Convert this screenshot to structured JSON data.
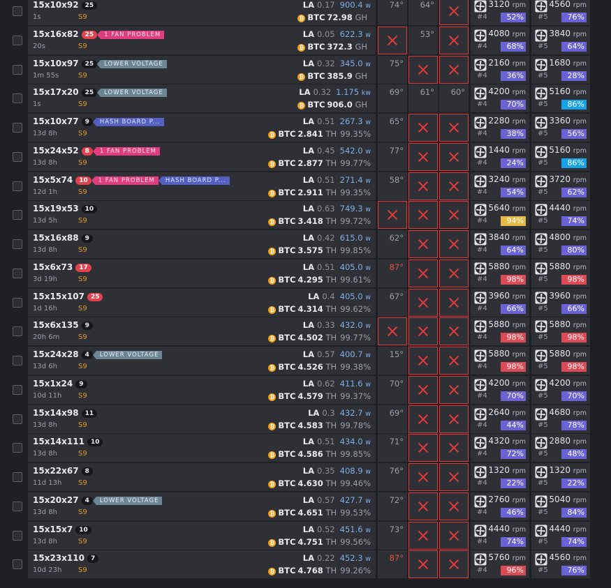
{
  "colors": {
    "pct_normal": "#6a63d6",
    "pct_warn": "#e5b946",
    "pct_danger": "#dc4a55",
    "pct_cyan": "#17a1e6"
  },
  "icons": {
    "fan": "fan-icon",
    "coin": "bitcoin-icon"
  },
  "la_label": "LA",
  "coin_label": "BTC",
  "coin_glyph": "₿",
  "fan_ids": [
    "#4",
    "#5"
  ],
  "rpm_unit": "rpm",
  "rows": [
    {
      "name": "15x10x92",
      "count": "25",
      "count_red": false,
      "tags": [],
      "age": "1s",
      "model": "S9",
      "la": "0.17",
      "power": "900.4",
      "power_unit": "w",
      "hashrate": "72.98",
      "hash_unit": "GH",
      "eff": "",
      "temps": [
        {
          "v": "74°",
          "err": false,
          "hot": false
        },
        {
          "v": "64°",
          "err": false,
          "hot": false
        },
        {
          "v": "",
          "err": true,
          "hot": false
        }
      ],
      "fans": [
        {
          "rpm": "3120",
          "pct": "52%",
          "color": "normal"
        },
        {
          "rpm": "4560",
          "pct": "76%",
          "color": "normal"
        }
      ]
    },
    {
      "name": "15x16x82",
      "count": "25",
      "count_red": true,
      "tags": [
        {
          "t": "1 FAN PROBLEM",
          "k": "fan"
        }
      ],
      "age": "20s",
      "model": "S9",
      "la": "0.05",
      "power": "622.3",
      "power_unit": "w",
      "hashrate": "372.3",
      "hash_unit": "GH",
      "eff": "",
      "temps": [
        {
          "v": "",
          "err": true,
          "hot": false
        },
        {
          "v": "53°",
          "err": false,
          "hot": false
        },
        {
          "v": "",
          "err": true,
          "hot": false
        }
      ],
      "fans": [
        {
          "rpm": "4080",
          "pct": "68%",
          "color": "normal"
        },
        {
          "rpm": "3840",
          "pct": "64%",
          "color": "normal"
        }
      ]
    },
    {
      "name": "15x10x97",
      "count": "25",
      "count_red": false,
      "tags": [
        {
          "t": "LOWER VOLTAGE",
          "k": "volt"
        }
      ],
      "age": "1m 55s",
      "model": "S9",
      "la": "0.32",
      "power": "345.0",
      "power_unit": "w",
      "hashrate": "385.9",
      "hash_unit": "GH",
      "eff": "",
      "temps": [
        {
          "v": "75°",
          "err": false,
          "hot": false
        },
        {
          "v": "",
          "err": true,
          "hot": false
        },
        {
          "v": "",
          "err": true,
          "hot": false
        }
      ],
      "fans": [
        {
          "rpm": "2160",
          "pct": "36%",
          "color": "normal"
        },
        {
          "rpm": "1680",
          "pct": "28%",
          "color": "normal"
        }
      ]
    },
    {
      "name": "15x17x20",
      "count": "25",
      "count_red": false,
      "tags": [
        {
          "t": "LOWER VOLTAGE",
          "k": "volt"
        }
      ],
      "age": "1s",
      "model": "S9",
      "la": "0.32",
      "power": "1.175",
      "power_unit": "kw",
      "hashrate": "906.0",
      "hash_unit": "GH",
      "eff": "",
      "temps": [
        {
          "v": "69°",
          "err": false,
          "hot": false
        },
        {
          "v": "61°",
          "err": false,
          "hot": false
        },
        {
          "v": "60°",
          "err": false,
          "hot": false
        }
      ],
      "fans": [
        {
          "rpm": "4200",
          "pct": "70%",
          "color": "normal"
        },
        {
          "rpm": "5160",
          "pct": "86%",
          "color": "cyan"
        }
      ]
    },
    {
      "name": "15x10x77",
      "count": "9",
      "count_red": false,
      "tags": [
        {
          "t": "HASH BOARD P...",
          "k": "hb"
        }
      ],
      "age": "13d 8h",
      "model": "S9",
      "la": "0.51",
      "power": "267.3",
      "power_unit": "w",
      "hashrate": "2.841",
      "hash_unit": "TH",
      "eff": "99.35%",
      "temps": [
        {
          "v": "65°",
          "err": false,
          "hot": false
        },
        {
          "v": "",
          "err": true,
          "hot": false
        },
        {
          "v": "",
          "err": true,
          "hot": false
        }
      ],
      "fans": [
        {
          "rpm": "2280",
          "pct": "38%",
          "color": "normal"
        },
        {
          "rpm": "3360",
          "pct": "56%",
          "color": "normal"
        }
      ]
    },
    {
      "name": "15x24x52",
      "count": "8",
      "count_red": true,
      "tags": [
        {
          "t": "1 FAN PROBLEM",
          "k": "fan"
        }
      ],
      "age": "13d 8h",
      "model": "S9",
      "la": "0.45",
      "power": "542.0",
      "power_unit": "w",
      "hashrate": "2.877",
      "hash_unit": "TH",
      "eff": "99.77%",
      "temps": [
        {
          "v": "77°",
          "err": false,
          "hot": false
        },
        {
          "v": "",
          "err": true,
          "hot": false
        },
        {
          "v": "",
          "err": true,
          "hot": false
        }
      ],
      "fans": [
        {
          "rpm": "1440",
          "pct": "24%",
          "color": "normal"
        },
        {
          "rpm": "5160",
          "pct": "86%",
          "color": "cyan"
        }
      ]
    },
    {
      "name": "15x5x74",
      "count": "10",
      "count_red": true,
      "tags": [
        {
          "t": "1 FAN PROBLEM",
          "k": "fan"
        },
        {
          "t": "HASH BOARD P...",
          "k": "hb"
        }
      ],
      "age": "12d 1h",
      "model": "S9",
      "la": "0.51",
      "power": "271.4",
      "power_unit": "w",
      "hashrate": "2.911",
      "hash_unit": "TH",
      "eff": "99.35%",
      "temps": [
        {
          "v": "58°",
          "err": false,
          "hot": false
        },
        {
          "v": "",
          "err": true,
          "hot": false
        },
        {
          "v": "",
          "err": true,
          "hot": false
        }
      ],
      "fans": [
        {
          "rpm": "3240",
          "pct": "54%",
          "color": "normal"
        },
        {
          "rpm": "3720",
          "pct": "62%",
          "color": "normal"
        }
      ]
    },
    {
      "name": "15x19x53",
      "count": "10",
      "count_red": false,
      "tags": [],
      "age": "13d 5h",
      "model": "S9",
      "la": "0.63",
      "power": "749.3",
      "power_unit": "w",
      "hashrate": "3.418",
      "hash_unit": "TH",
      "eff": "99.72%",
      "temps": [
        {
          "v": "",
          "err": true,
          "hot": false
        },
        {
          "v": "",
          "err": true,
          "hot": false
        },
        {
          "v": "",
          "err": true,
          "hot": false
        }
      ],
      "fans": [
        {
          "rpm": "5640",
          "pct": "94%",
          "color": "warn"
        },
        {
          "rpm": "4440",
          "pct": "74%",
          "color": "normal"
        }
      ]
    },
    {
      "name": "15x16x88",
      "count": "9",
      "count_red": false,
      "tags": [],
      "age": "13d 8h",
      "model": "S9",
      "la": "0.42",
      "power": "615.0",
      "power_unit": "w",
      "hashrate": "3.575",
      "hash_unit": "TH",
      "eff": "99.85%",
      "temps": [
        {
          "v": "62°",
          "err": false,
          "hot": false
        },
        {
          "v": "",
          "err": true,
          "hot": false
        },
        {
          "v": "",
          "err": true,
          "hot": false
        }
      ],
      "fans": [
        {
          "rpm": "3840",
          "pct": "64%",
          "color": "normal"
        },
        {
          "rpm": "4800",
          "pct": "80%",
          "color": "normal"
        }
      ]
    },
    {
      "name": "15x6x73",
      "count": "17",
      "count_red": true,
      "tags": [],
      "age": "3d 19h",
      "model": "S9",
      "la": "0.51",
      "power": "405.0",
      "power_unit": "w",
      "hashrate": "4.295",
      "hash_unit": "TH",
      "eff": "99.61%",
      "temps": [
        {
          "v": "87°",
          "err": false,
          "hot": true
        },
        {
          "v": "",
          "err": true,
          "hot": false
        },
        {
          "v": "",
          "err": true,
          "hot": false
        }
      ],
      "fans": [
        {
          "rpm": "5880",
          "pct": "98%",
          "color": "danger"
        },
        {
          "rpm": "5880",
          "pct": "98%",
          "color": "danger"
        }
      ]
    },
    {
      "name": "15x15x107",
      "count": "25",
      "count_red": true,
      "tags": [],
      "age": "1d 16h",
      "model": "S9",
      "la": "0.4",
      "power": "405.0",
      "power_unit": "w",
      "hashrate": "4.314",
      "hash_unit": "TH",
      "eff": "99.62%",
      "temps": [
        {
          "v": "67°",
          "err": false,
          "hot": false
        },
        {
          "v": "",
          "err": true,
          "hot": false
        },
        {
          "v": "",
          "err": true,
          "hot": false
        }
      ],
      "fans": [
        {
          "rpm": "3960",
          "pct": "66%",
          "color": "normal"
        },
        {
          "rpm": "3960",
          "pct": "66%",
          "color": "normal"
        }
      ]
    },
    {
      "name": "15x6x135",
      "count": "9",
      "count_red": false,
      "tags": [],
      "age": "20h 6m",
      "model": "S9",
      "la": "0.33",
      "power": "432.0",
      "power_unit": "w",
      "hashrate": "4.502",
      "hash_unit": "TH",
      "eff": "99.77%",
      "temps": [
        {
          "v": "",
          "err": true,
          "hot": false
        },
        {
          "v": "",
          "err": true,
          "hot": false
        },
        {
          "v": "",
          "err": true,
          "hot": false
        }
      ],
      "fans": [
        {
          "rpm": "5880",
          "pct": "98%",
          "color": "danger"
        },
        {
          "rpm": "5880",
          "pct": "98%",
          "color": "danger"
        }
      ]
    },
    {
      "name": "15x24x28",
      "count": "4",
      "count_red": false,
      "tags": [
        {
          "t": "LOWER VOLTAGE",
          "k": "volt"
        }
      ],
      "age": "13d 6h",
      "model": "S9",
      "la": "0.57",
      "power": "400.7",
      "power_unit": "w",
      "hashrate": "4.526",
      "hash_unit": "TH",
      "eff": "99.38%",
      "temps": [
        {
          "v": "15°",
          "err": false,
          "hot": false
        },
        {
          "v": "",
          "err": true,
          "hot": false
        },
        {
          "v": "",
          "err": true,
          "hot": false
        }
      ],
      "fans": [
        {
          "rpm": "5880",
          "pct": "98%",
          "color": "danger"
        },
        {
          "rpm": "5880",
          "pct": "98%",
          "color": "danger"
        }
      ]
    },
    {
      "name": "15x1x24",
      "count": "9",
      "count_red": false,
      "tags": [],
      "age": "10d 11h",
      "model": "S9",
      "la": "0.62",
      "power": "411.6",
      "power_unit": "w",
      "hashrate": "4.579",
      "hash_unit": "TH",
      "eff": "99.37%",
      "temps": [
        {
          "v": "70°",
          "err": false,
          "hot": false
        },
        {
          "v": "",
          "err": true,
          "hot": false
        },
        {
          "v": "",
          "err": true,
          "hot": false
        }
      ],
      "fans": [
        {
          "rpm": "4200",
          "pct": "70%",
          "color": "normal"
        },
        {
          "rpm": "4200",
          "pct": "70%",
          "color": "normal"
        }
      ]
    },
    {
      "name": "15x14x98",
      "count": "11",
      "count_red": false,
      "tags": [],
      "age": "13d 8h",
      "model": "S9",
      "la": "0.3",
      "power": "432.7",
      "power_unit": "w",
      "hashrate": "4.583",
      "hash_unit": "TH",
      "eff": "99.78%",
      "temps": [
        {
          "v": "69°",
          "err": false,
          "hot": false
        },
        {
          "v": "",
          "err": true,
          "hot": false
        },
        {
          "v": "",
          "err": true,
          "hot": false
        }
      ],
      "fans": [
        {
          "rpm": "2640",
          "pct": "44%",
          "color": "normal"
        },
        {
          "rpm": "4680",
          "pct": "78%",
          "color": "normal"
        }
      ]
    },
    {
      "name": "15x14x111",
      "count": "10",
      "count_red": false,
      "tags": [],
      "age": "13d 8h",
      "model": "S9",
      "la": "0.51",
      "power": "434.0",
      "power_unit": "w",
      "hashrate": "4.586",
      "hash_unit": "TH",
      "eff": "99.85%",
      "temps": [
        {
          "v": "71°",
          "err": false,
          "hot": false
        },
        {
          "v": "",
          "err": true,
          "hot": false
        },
        {
          "v": "",
          "err": true,
          "hot": false
        }
      ],
      "fans": [
        {
          "rpm": "4320",
          "pct": "72%",
          "color": "normal"
        },
        {
          "rpm": "2880",
          "pct": "48%",
          "color": "normal"
        }
      ]
    },
    {
      "name": "15x22x67",
      "count": "8",
      "count_red": false,
      "tags": [],
      "age": "11d 13h",
      "model": "S9",
      "la": "0.35",
      "power": "408.9",
      "power_unit": "w",
      "hashrate": "4.630",
      "hash_unit": "TH",
      "eff": "99.46%",
      "temps": [
        {
          "v": "76°",
          "err": false,
          "hot": false
        },
        {
          "v": "",
          "err": true,
          "hot": false
        },
        {
          "v": "",
          "err": true,
          "hot": false
        }
      ],
      "fans": [
        {
          "rpm": "1320",
          "pct": "22%",
          "color": "normal"
        },
        {
          "rpm": "1320",
          "pct": "22%",
          "color": "normal"
        }
      ]
    },
    {
      "name": "15x20x27",
      "count": "4",
      "count_red": false,
      "tags": [
        {
          "t": "LOWER VOLTAGE",
          "k": "volt"
        }
      ],
      "age": "13d 8h",
      "model": "S9",
      "la": "0.57",
      "power": "427.7",
      "power_unit": "w",
      "hashrate": "4.651",
      "hash_unit": "TH",
      "eff": "99.53%",
      "temps": [
        {
          "v": "72°",
          "err": false,
          "hot": false
        },
        {
          "v": "",
          "err": true,
          "hot": false
        },
        {
          "v": "",
          "err": true,
          "hot": false
        }
      ],
      "fans": [
        {
          "rpm": "2760",
          "pct": "46%",
          "color": "normal"
        },
        {
          "rpm": "5040",
          "pct": "84%",
          "color": "normal"
        }
      ]
    },
    {
      "name": "15x15x7",
      "count": "10",
      "count_red": false,
      "tags": [],
      "age": "13d 8h",
      "model": "S9",
      "la": "0.52",
      "power": "451.6",
      "power_unit": "w",
      "hashrate": "4.751",
      "hash_unit": "TH",
      "eff": "99.56%",
      "temps": [
        {
          "v": "73°",
          "err": false,
          "hot": false
        },
        {
          "v": "",
          "err": true,
          "hot": false
        },
        {
          "v": "",
          "err": true,
          "hot": false
        }
      ],
      "fans": [
        {
          "rpm": "4440",
          "pct": "74%",
          "color": "normal"
        },
        {
          "rpm": "4440",
          "pct": "74%",
          "color": "normal"
        }
      ]
    },
    {
      "name": "15x23x110",
      "count": "7",
      "count_red": false,
      "tags": [],
      "age": "10d 23h",
      "model": "S9",
      "la": "0.22",
      "power": "452.3",
      "power_unit": "w",
      "hashrate": "4.768",
      "hash_unit": "TH",
      "eff": "99.26%",
      "temps": [
        {
          "v": "87°",
          "err": false,
          "hot": true
        },
        {
          "v": "",
          "err": true,
          "hot": false
        },
        {
          "v": "",
          "err": true,
          "hot": false
        }
      ],
      "fans": [
        {
          "rpm": "5760",
          "pct": "96%",
          "color": "danger"
        },
        {
          "rpm": "4560",
          "pct": "76%",
          "color": "normal"
        }
      ]
    }
  ]
}
